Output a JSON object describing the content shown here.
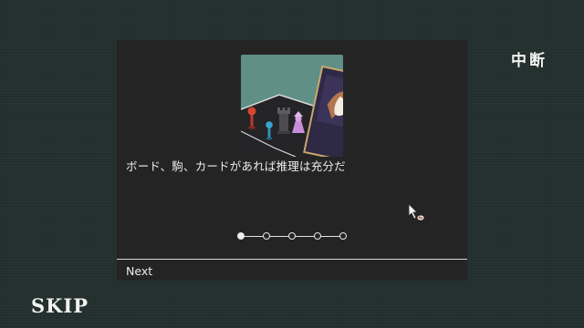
{
  "suspend": {
    "label": "中断"
  },
  "skip": {
    "label": "SKIP"
  },
  "tutorial": {
    "text": "ボード、駒、カードがあれば推理は充分だ",
    "next_label": "Next",
    "page_count": 5,
    "current_page": 1,
    "illustration_icon": "board-pieces-card-illustration"
  },
  "colors": {
    "background": "#23302d",
    "panel": "#242425",
    "text": "#ececec"
  }
}
